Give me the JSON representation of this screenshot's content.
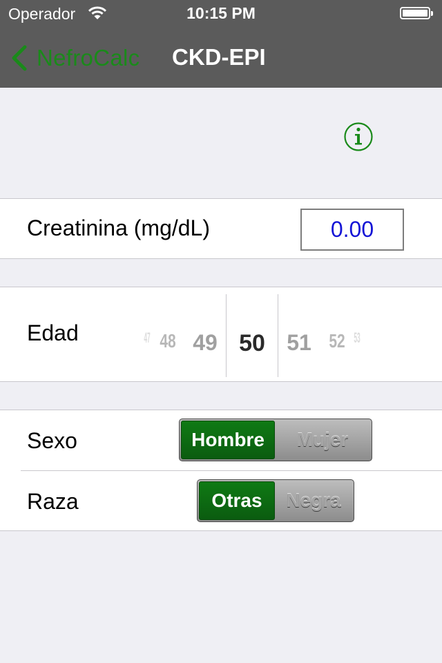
{
  "status_bar": {
    "carrier": "Operador",
    "time": "10:15 PM"
  },
  "nav": {
    "back_label": "NefroCalc",
    "title": "CKD-EPI"
  },
  "colors": {
    "accent": "#1a8a1a",
    "nav_bg": "#5b5b5b",
    "input_text": "#1414d6",
    "segment_selected": "#0b6a10"
  },
  "icons": {
    "back": "chevron-left-icon",
    "info": "info-circle-icon",
    "wifi": "wifi-icon",
    "battery": "battery-icon"
  },
  "creatinina": {
    "label": "Creatinina (mg/dL)",
    "value": "0.00"
  },
  "edad": {
    "label": "Edad",
    "picker": {
      "v47": "47",
      "v48": "48",
      "v49": "49",
      "selected": "50",
      "v51": "51",
      "v52": "52",
      "v53": "53"
    }
  },
  "sexo": {
    "label": "Sexo",
    "options": [
      "Hombre",
      "Mujer"
    ],
    "selected": "Hombre"
  },
  "raza": {
    "label": "Raza",
    "options": [
      "Otras",
      "Negra"
    ],
    "selected": "Otras"
  }
}
